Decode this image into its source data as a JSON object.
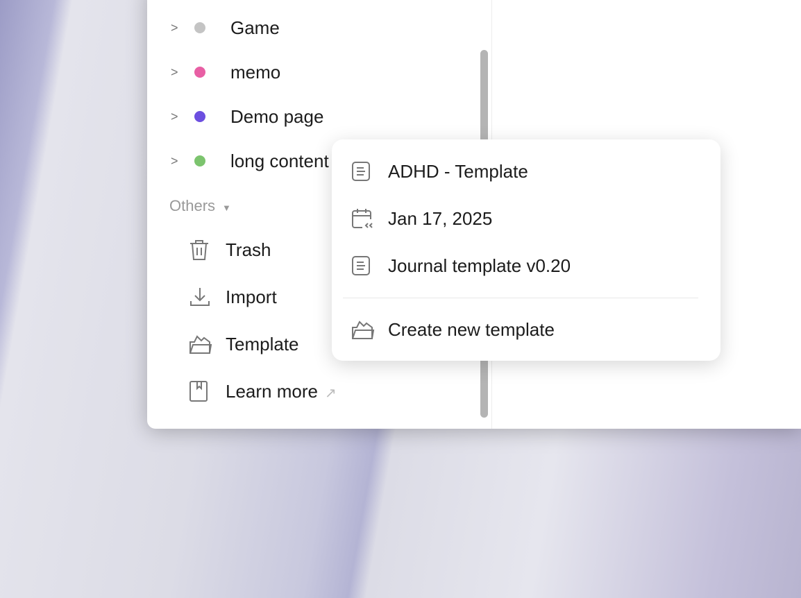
{
  "sidebar": {
    "pages": [
      {
        "label": "Game",
        "color": "#c4c4c4"
      },
      {
        "label": "memo",
        "color": "#e85fa4"
      },
      {
        "label": "Demo page",
        "color": "#6c4fe0"
      },
      {
        "label": "long content",
        "color": "#7cc46e"
      }
    ],
    "others_label": "Others",
    "others": [
      {
        "label": "Trash",
        "icon": "trash-icon"
      },
      {
        "label": "Import",
        "icon": "download-icon"
      },
      {
        "label": "Template",
        "icon": "folder-open-icon"
      },
      {
        "label": "Learn more",
        "icon": "book-icon",
        "external": "↗"
      }
    ]
  },
  "template_menu": {
    "items": [
      {
        "label": "ADHD - Template",
        "icon": "document-icon"
      },
      {
        "label": "Jan 17, 2025",
        "icon": "calendar-icon"
      },
      {
        "label": "Journal template v0.20",
        "icon": "document-icon"
      }
    ],
    "create_label": "Create new template"
  }
}
